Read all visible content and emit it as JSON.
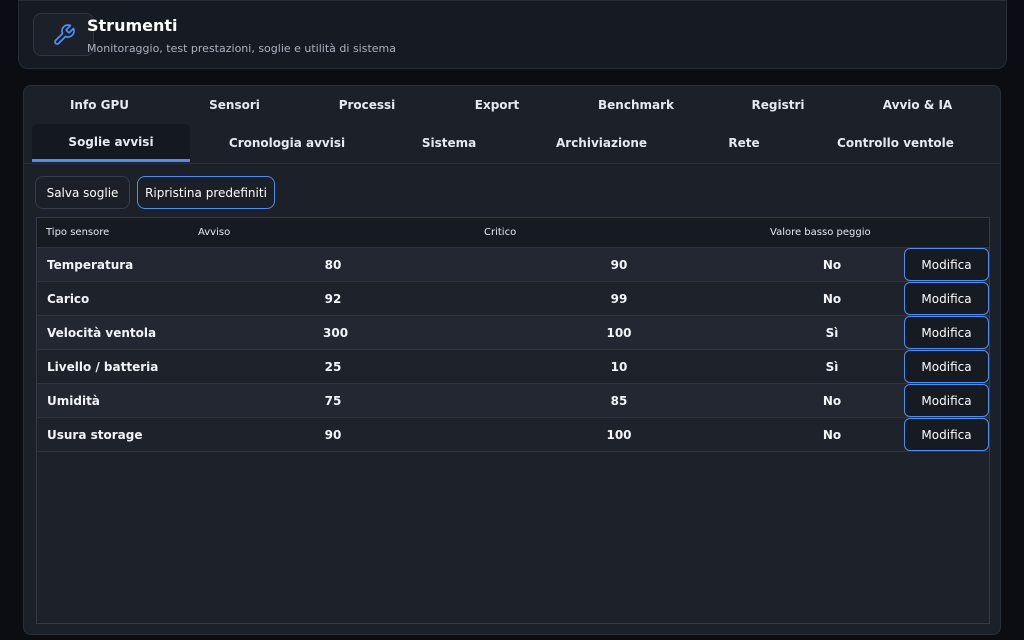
{
  "header": {
    "title": "Strumenti",
    "subtitle": "Monitoraggio, test prestazioni, soglie e utilità di sistema",
    "icon": "wrench-icon"
  },
  "tabs_row1": [
    "Info GPU",
    "Sensori",
    "Processi",
    "Export",
    "Benchmark",
    "Registri",
    "Avvio & IA"
  ],
  "tabs_row2": [
    "Soglie avvisi",
    "Cronologia avvisi",
    "Sistema",
    "Archiviazione",
    "Rete",
    "Controllo ventole"
  ],
  "active_tab": "Soglie avvisi",
  "actions": {
    "save_label": "Salva soglie",
    "reset_label": "Ripristina predefiniti"
  },
  "table": {
    "headers": [
      "Tipo sensore",
      "Avviso",
      "Critico",
      "Valore basso peggio"
    ],
    "edit_label": "Modifica",
    "rows": [
      {
        "name": "Temperatura",
        "warn": "80",
        "crit": "90",
        "low": "No"
      },
      {
        "name": "Carico",
        "warn": "92",
        "crit": "99",
        "low": "No"
      },
      {
        "name": "Velocità ventola",
        "warn": "300",
        "crit": "100",
        "low": "Sì"
      },
      {
        "name": "Livello / batteria",
        "warn": "25",
        "crit": "10",
        "low": "Sì"
      },
      {
        "name": "Umidità",
        "warn": "75",
        "crit": "85",
        "low": "No"
      },
      {
        "name": "Usura storage",
        "warn": "90",
        "crit": "100",
        "low": "No"
      }
    ]
  },
  "colors": {
    "accent": "#4d8ef0",
    "background": "#0b0d12",
    "panel": "#1c2029"
  }
}
